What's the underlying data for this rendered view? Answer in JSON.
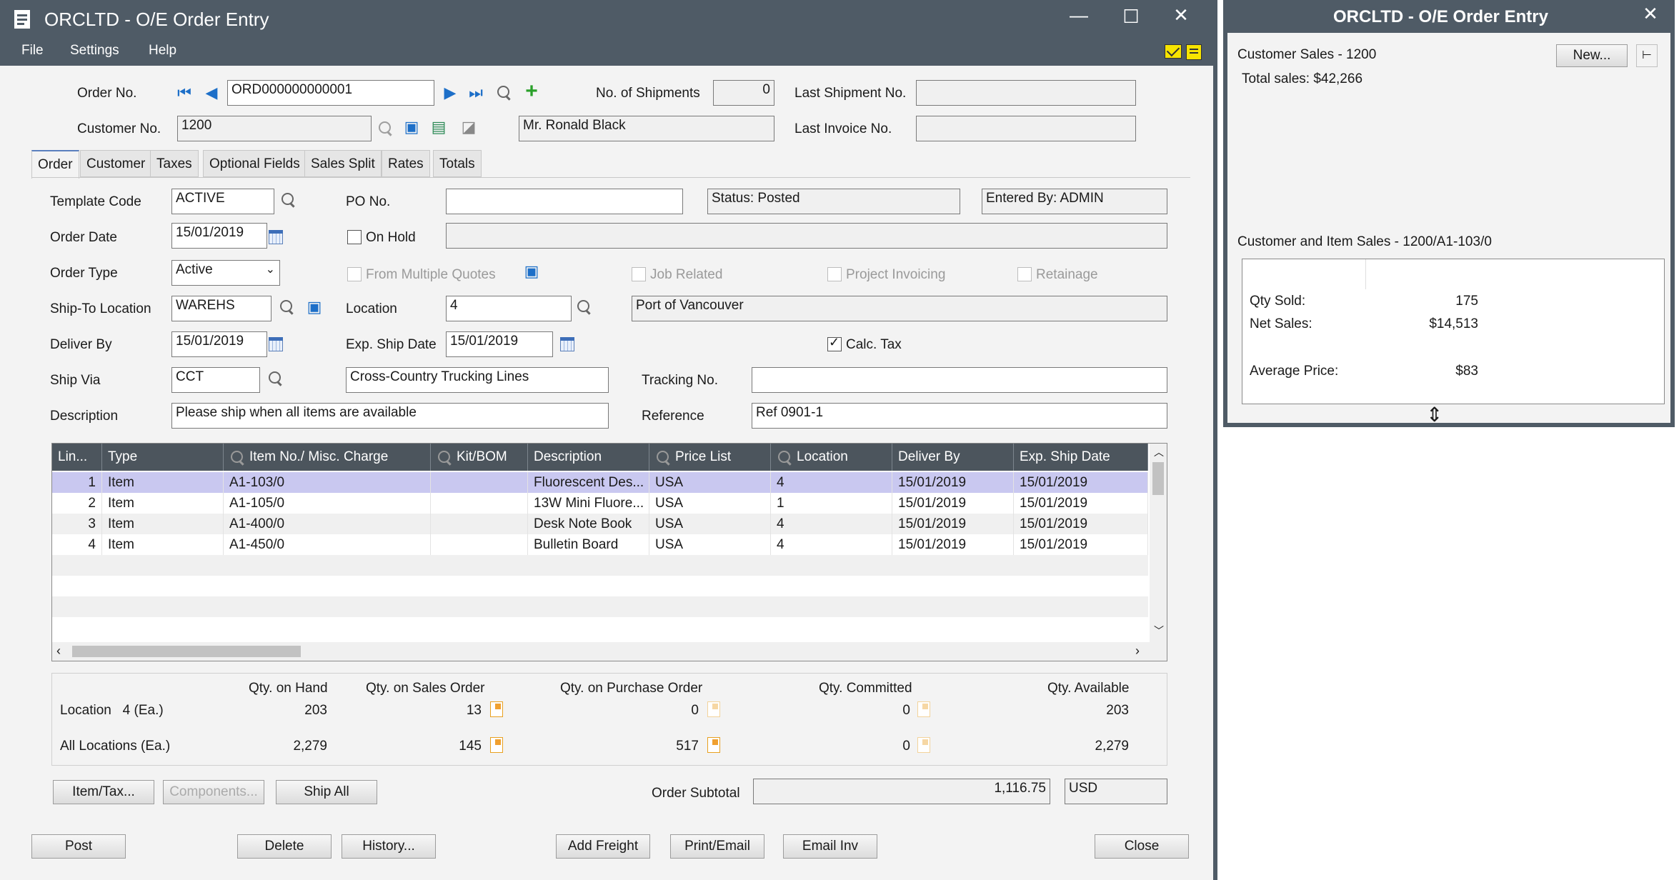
{
  "main_window": {
    "title": "ORCLTD - O/E Order Entry",
    "menu": [
      "File",
      "Settings",
      "Help"
    ],
    "header": {
      "order_no_label": "Order No.",
      "order_no_value": "ORD000000000001",
      "shipments_label": "No. of Shipments",
      "shipments_value": "0",
      "last_shipment_label": "Last Shipment No.",
      "last_shipment_value": "",
      "customer_no_label": "Customer No.",
      "customer_no_value": "1200",
      "customer_name": "Mr. Ronald Black",
      "last_invoice_label": "Last Invoice No.",
      "last_invoice_value": ""
    },
    "tabs": [
      "Order",
      "Customer",
      "Taxes",
      "Optional Fields",
      "Sales Split",
      "Rates",
      "Totals"
    ],
    "form": {
      "template_code_label": "Template Code",
      "template_code": "ACTIVE",
      "po_no_label": "PO No.",
      "po_no": "",
      "status": "Status: Posted",
      "entered_by": "Entered By: ADMIN",
      "order_date_label": "Order Date",
      "order_date": "15/01/2019",
      "on_hold_label": "On Hold",
      "on_hold_reason": "",
      "order_type_label": "Order Type",
      "order_type": "Active",
      "multiple_quotes_label": "From Multiple Quotes",
      "job_related_label": "Job Related",
      "project_invoicing_label": "Project Invoicing",
      "retainage_label": "Retainage",
      "ship_to_label": "Ship-To Location",
      "ship_to": "WAREHS",
      "location_label": "Location",
      "location": "4",
      "location_desc": "Port of Vancouver",
      "deliver_by_label": "Deliver By",
      "deliver_by": "15/01/2019",
      "exp_ship_label": "Exp. Ship Date",
      "exp_ship": "15/01/2019",
      "calc_tax_label": "Calc. Tax",
      "ship_via_label": "Ship Via",
      "ship_via": "CCT",
      "ship_via_desc": "Cross-Country Trucking Lines",
      "tracking_label": "Tracking No.",
      "tracking": "",
      "description_label": "Description",
      "description": "Please ship when all items are available",
      "reference_label": "Reference",
      "reference": "Ref 0901-1"
    },
    "grid": {
      "columns": [
        "Lin...",
        "Type",
        "Item No./ Misc. Charge",
        "Kit/BOM",
        "Description",
        "Price List",
        "Location",
        "Deliver By",
        "Exp. Ship Date"
      ],
      "rows": [
        {
          "line": "1",
          "type": "Item",
          "item": "A1-103/0",
          "kit": "",
          "desc": "Fluorescent Des...",
          "price_list": "USA",
          "location": "4",
          "deliver_by": "15/01/2019",
          "exp_ship": "15/01/2019"
        },
        {
          "line": "2",
          "type": "Item",
          "item": "A1-105/0",
          "kit": "",
          "desc": "13W Mini Fluore...",
          "price_list": "USA",
          "location": "1",
          "deliver_by": "15/01/2019",
          "exp_ship": "15/01/2019"
        },
        {
          "line": "3",
          "type": "Item",
          "item": "A1-400/0",
          "kit": "",
          "desc": "Desk Note Book",
          "price_list": "USA",
          "location": "4",
          "deliver_by": "15/01/2019",
          "exp_ship": "15/01/2019"
        },
        {
          "line": "4",
          "type": "Item",
          "item": "A1-450/0",
          "kit": "",
          "desc": "Bulletin Board",
          "price_list": "USA",
          "location": "4",
          "deliver_by": "15/01/2019",
          "exp_ship": "15/01/2019"
        }
      ]
    },
    "quantities": {
      "headers": [
        "Qty. on Hand",
        "Qty. on Sales Order",
        "Qty. on Purchase Order",
        "Qty. Committed",
        "Qty. Available"
      ],
      "location_label": "Location   4 (Ea.)",
      "location_values": [
        "203",
        "13",
        "0",
        "0",
        "203"
      ],
      "all_label": "All Locations (Ea.)",
      "all_values": [
        "2,279",
        "145",
        "517",
        "0",
        "2,279"
      ]
    },
    "buttons": {
      "item_tax": "Item/Tax...",
      "components": "Components...",
      "ship_all": "Ship All",
      "post": "Post",
      "delete": "Delete",
      "history": "History...",
      "add_freight": "Add Freight",
      "print_email": "Print/Email",
      "email_inv": "Email Inv",
      "close": "Close"
    },
    "subtotal_label": "Order Subtotal",
    "subtotal_value": "1,116.75",
    "currency": "USD"
  },
  "side_window": {
    "title": "ORCLTD - O/E Order Entry",
    "customer_sales_label": "Customer Sales - 1200",
    "total_sales": "Total sales: $42,266",
    "new_button": "New...",
    "item_sales_label": "Customer and Item Sales - 1200/A1-103/0",
    "qty_sold_label": "Qty Sold:",
    "qty_sold": "175",
    "net_sales_label": "Net Sales:",
    "net_sales": "$14,513",
    "avg_price_label": "Average Price:",
    "avg_price": "$83"
  },
  "colors": {
    "titlebar": "#4f5b66",
    "grid_header": "#4c555d",
    "selected_row": "#c9c8f0",
    "window_bg": "#f3f3f3"
  }
}
